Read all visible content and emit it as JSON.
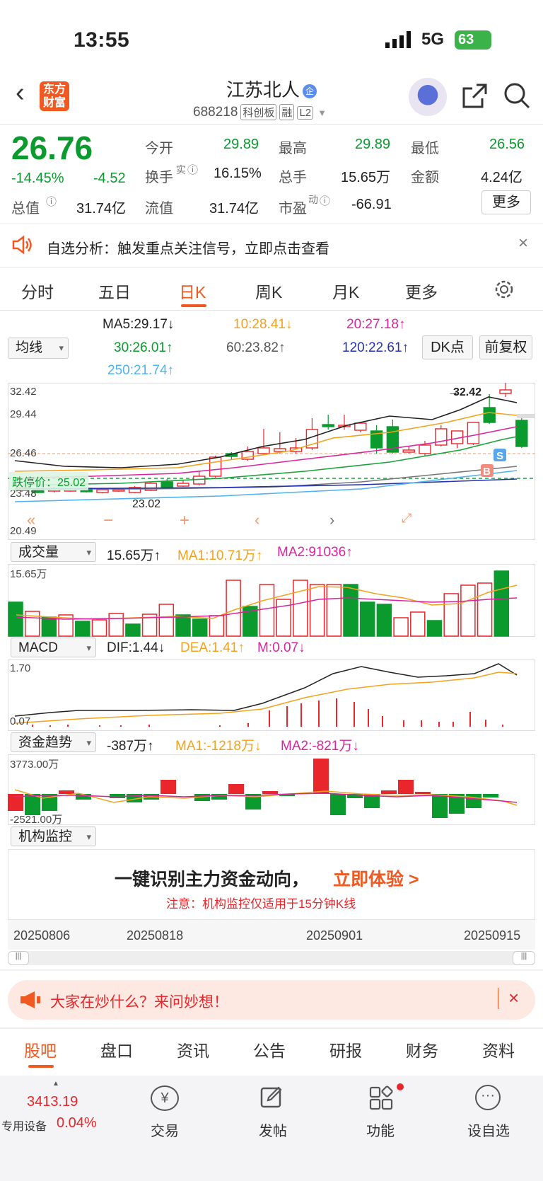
{
  "status": {
    "time": "13:55",
    "network": "5G",
    "battery": "63"
  },
  "header": {
    "logo": "东方财富",
    "name": "江苏北人",
    "name_badge": "企",
    "code": "688218",
    "tags": [
      "科创板",
      "融",
      "L2"
    ]
  },
  "quote": {
    "price": "26.76",
    "pct": "-14.45%",
    "chg": "-4.52",
    "rows": [
      [
        "今开",
        "29.89",
        "最高",
        "29.89",
        "最低",
        "26.56"
      ],
      [
        "换手",
        "16.15%",
        "总手",
        "15.65万",
        "金额",
        "4.24亿"
      ],
      [
        "总值",
        "31.74亿",
        "流值",
        "31.74亿",
        "市盈",
        "-66.91"
      ]
    ],
    "turnover_sup": "实",
    "pe_sup": "动",
    "more": "更多"
  },
  "notice": {
    "text": "自选分析：触发重点关注信号，立即点击查看"
  },
  "tabs": [
    "分时",
    "五日",
    "日K",
    "周K",
    "月K",
    "更多"
  ],
  "ma": {
    "select": "均线",
    "ma5": "MA5:29.17↓",
    "ma10": "10:28.41↓",
    "ma20": "20:27.18↑",
    "ma30": "30:26.01↑",
    "ma60": "60:23.82↑",
    "ma120": "120:22.61↑",
    "ma250": "250:21.74↑",
    "dk": "DK点",
    "fq": "前复权"
  },
  "kline": {
    "ylabels": [
      "32.42",
      "29.44",
      "26.46",
      "23.48",
      "20.49"
    ],
    "limit": "跌停价：25.02",
    "hi": "32.42",
    "lo": "23.02",
    "s": "S",
    "b": "B"
  },
  "vol": {
    "select": "成交量",
    "v": "15.65万↑",
    "ma1": "MA1:10.71万↑",
    "ma2": "MA2:91036↑",
    "top": "15.65万"
  },
  "macd": {
    "select": "MACD",
    "dif": "DIF:1.44↓",
    "dea": "DEA:1.41↑",
    "m": "M:0.07↓",
    "top": "1.70",
    "bot": "0.07"
  },
  "flow": {
    "select": "资金趋势",
    "v": "-387万↑",
    "ma1": "MA1:-1218万↓",
    "ma2": "MA2:-821万↓",
    "top": "3773.00万",
    "bot": "-2521.00万"
  },
  "inst": {
    "select": "机构监控",
    "title": "一键识别主力资金动向，",
    "cta": "立即体验 >",
    "note": "注意：机构监控仅适用于15分钟K线"
  },
  "dates": [
    "20250806",
    "20250818",
    "20250901",
    "20250915"
  ],
  "ask": {
    "text": "大家在炒什么？来问妙想！"
  },
  "bottomtabs": [
    "股吧",
    "盘口",
    "资讯",
    "公告",
    "研报",
    "财务",
    "资料"
  ],
  "footer": {
    "index": "3413.19",
    "sector": "专用设备",
    "sector_pct": "0.04%",
    "trade": "交易",
    "post": "发帖",
    "func": "功能",
    "watch": "设自选"
  },
  "colors": {
    "up": "#e8262b",
    "down": "#0a9a2e",
    "accent": "#f05a22"
  }
}
